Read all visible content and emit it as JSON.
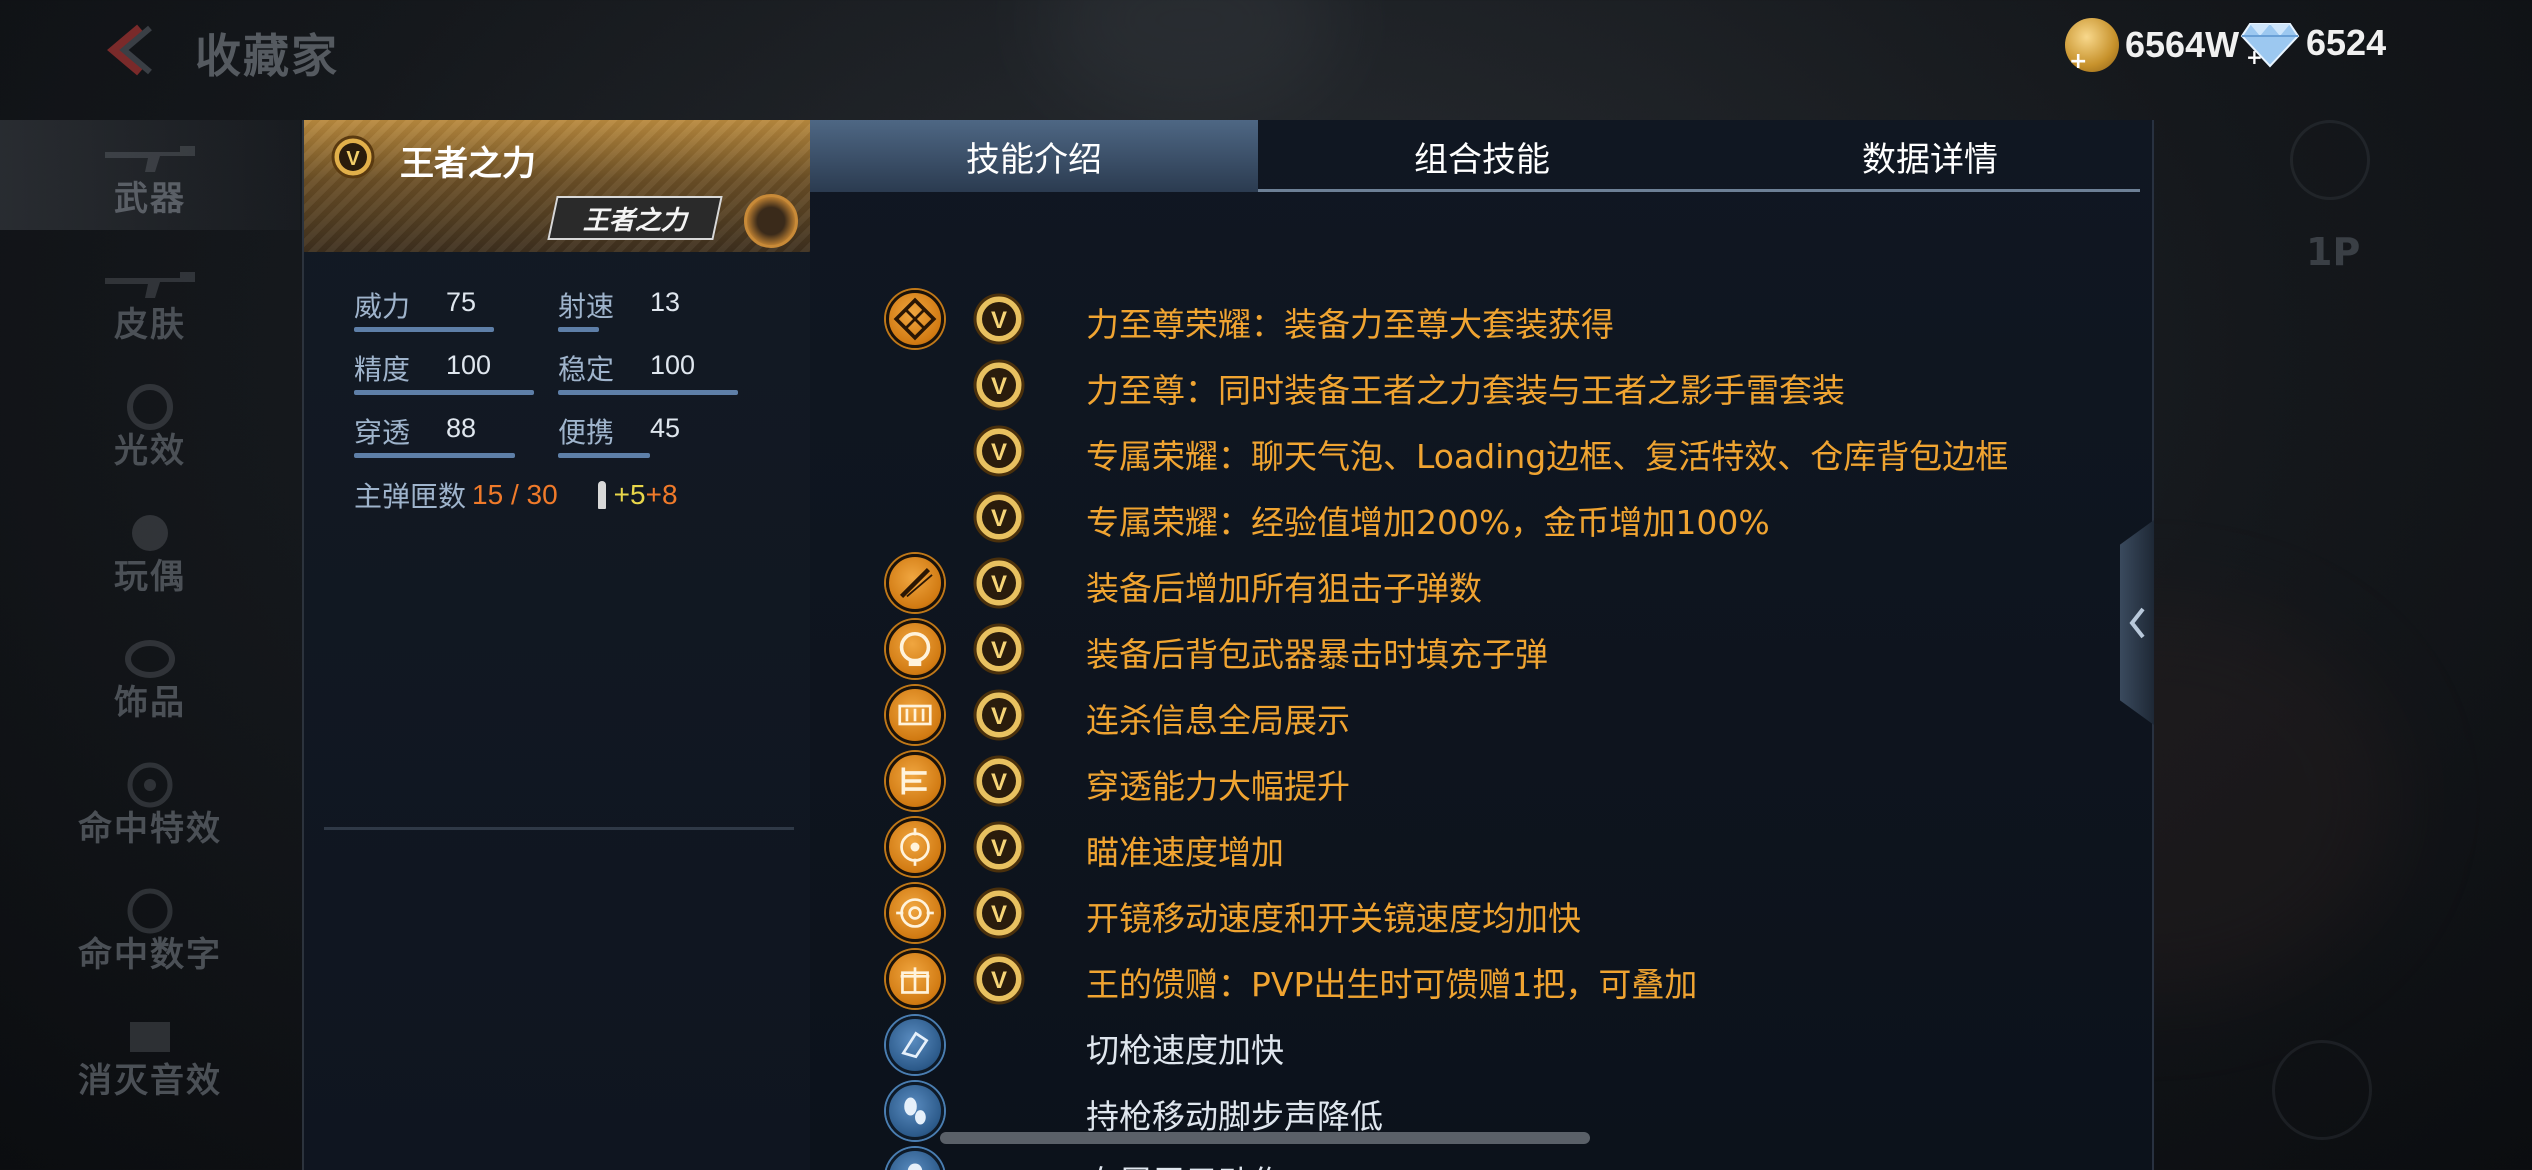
{
  "topbar": {
    "title": "收藏家",
    "gold": {
      "value": "6564W",
      "icon": "gold-coin-icon"
    },
    "diamond": {
      "value": "6524",
      "icon": "diamond-icon"
    }
  },
  "nav": {
    "items": [
      {
        "label": "武器",
        "active": true
      },
      {
        "label": "皮肤"
      },
      {
        "label": "光效"
      },
      {
        "label": "玩偶"
      },
      {
        "label": "饰品"
      },
      {
        "label": "命中特效"
      },
      {
        "label": "命中数字"
      },
      {
        "label": "消灭音效"
      }
    ]
  },
  "weapon": {
    "name": "王者之力",
    "logo_text": "王者之力",
    "stats": [
      {
        "label": "威力",
        "value": "75",
        "ratio": 0.75
      },
      {
        "label": "射速",
        "value": "13",
        "ratio": 0.13
      },
      {
        "label": "精度",
        "value": "100",
        "ratio": 1.0
      },
      {
        "label": "稳定",
        "value": "100",
        "ratio": 1.0
      },
      {
        "label": "穿透",
        "value": "88",
        "ratio": 0.88
      },
      {
        "label": "便携",
        "value": "45",
        "ratio": 0.45
      }
    ],
    "ammo": {
      "label": "主弹匣数",
      "value": "15 / 30",
      "plus1": "+5",
      "plus2": "+8"
    }
  },
  "tabs": [
    {
      "label": "技能介绍",
      "active": true
    },
    {
      "label": "组合技能"
    },
    {
      "label": "数据详情"
    }
  ],
  "skills": [
    {
      "icon": "diamond-pattern-icon",
      "icon_color": "gold",
      "has_v": true,
      "text": "力至尊荣耀：装备力至尊大套装获得",
      "text_color": "gold"
    },
    {
      "icon": "",
      "icon_color": "",
      "has_v": true,
      "text": "力至尊：同时装备王者之力套装与王者之影手雷套装",
      "text_color": "gold"
    },
    {
      "icon": "",
      "icon_color": "",
      "has_v": true,
      "text": "专属荣耀：聊天气泡、Loading边框、复活特效、仓库背包边框",
      "text_color": "gold"
    },
    {
      "icon": "",
      "icon_color": "",
      "has_v": true,
      "text": "专属荣耀：经验值增加200%，金币增加100%",
      "text_color": "gold"
    },
    {
      "icon": "sniper-ammo-icon",
      "icon_color": "gold",
      "has_v": true,
      "text": "装备后增加所有狙击子弹数",
      "text_color": "gold"
    },
    {
      "icon": "backpack-crit-icon",
      "icon_color": "gold",
      "has_v": true,
      "text": "装备后背包武器暴击时填充子弹",
      "text_color": "gold"
    },
    {
      "icon": "killstreak-icon",
      "icon_color": "gold",
      "has_v": true,
      "text": "连杀信息全局展示",
      "text_color": "gold"
    },
    {
      "icon": "penetration-icon",
      "icon_color": "gold",
      "has_v": true,
      "text": "穿透能力大幅提升",
      "text_color": "gold"
    },
    {
      "icon": "crosshair-icon",
      "icon_color": "gold",
      "has_v": true,
      "text": "瞄准速度增加",
      "text_color": "gold"
    },
    {
      "icon": "scope-icon",
      "icon_color": "gold",
      "has_v": true,
      "text": "开镜移动速度和开关镜速度均加快",
      "text_color": "gold"
    },
    {
      "icon": "gift-icon",
      "icon_color": "gold",
      "has_v": true,
      "text": "王的馈赠：PVP出生时可馈赠1把，可叠加",
      "text_color": "gold"
    },
    {
      "icon": "weapon-switch-icon",
      "icon_color": "blue",
      "has_v": false,
      "text": "切枪速度加快",
      "text_color": "white"
    },
    {
      "icon": "footstep-icon",
      "icon_color": "blue",
      "has_v": false,
      "text": "持枪移动脚步声降低",
      "text_color": "white"
    },
    {
      "icon": "display-action-icon",
      "icon_color": "blue",
      "has_v": false,
      "text": "专属展示动作",
      "text_color": "white"
    }
  ],
  "right": {
    "label_1p": "1P"
  },
  "colors": {
    "gold_text": "#f0a431",
    "tab_active": "#4e6784",
    "accent_orange": "#f07a2a"
  }
}
